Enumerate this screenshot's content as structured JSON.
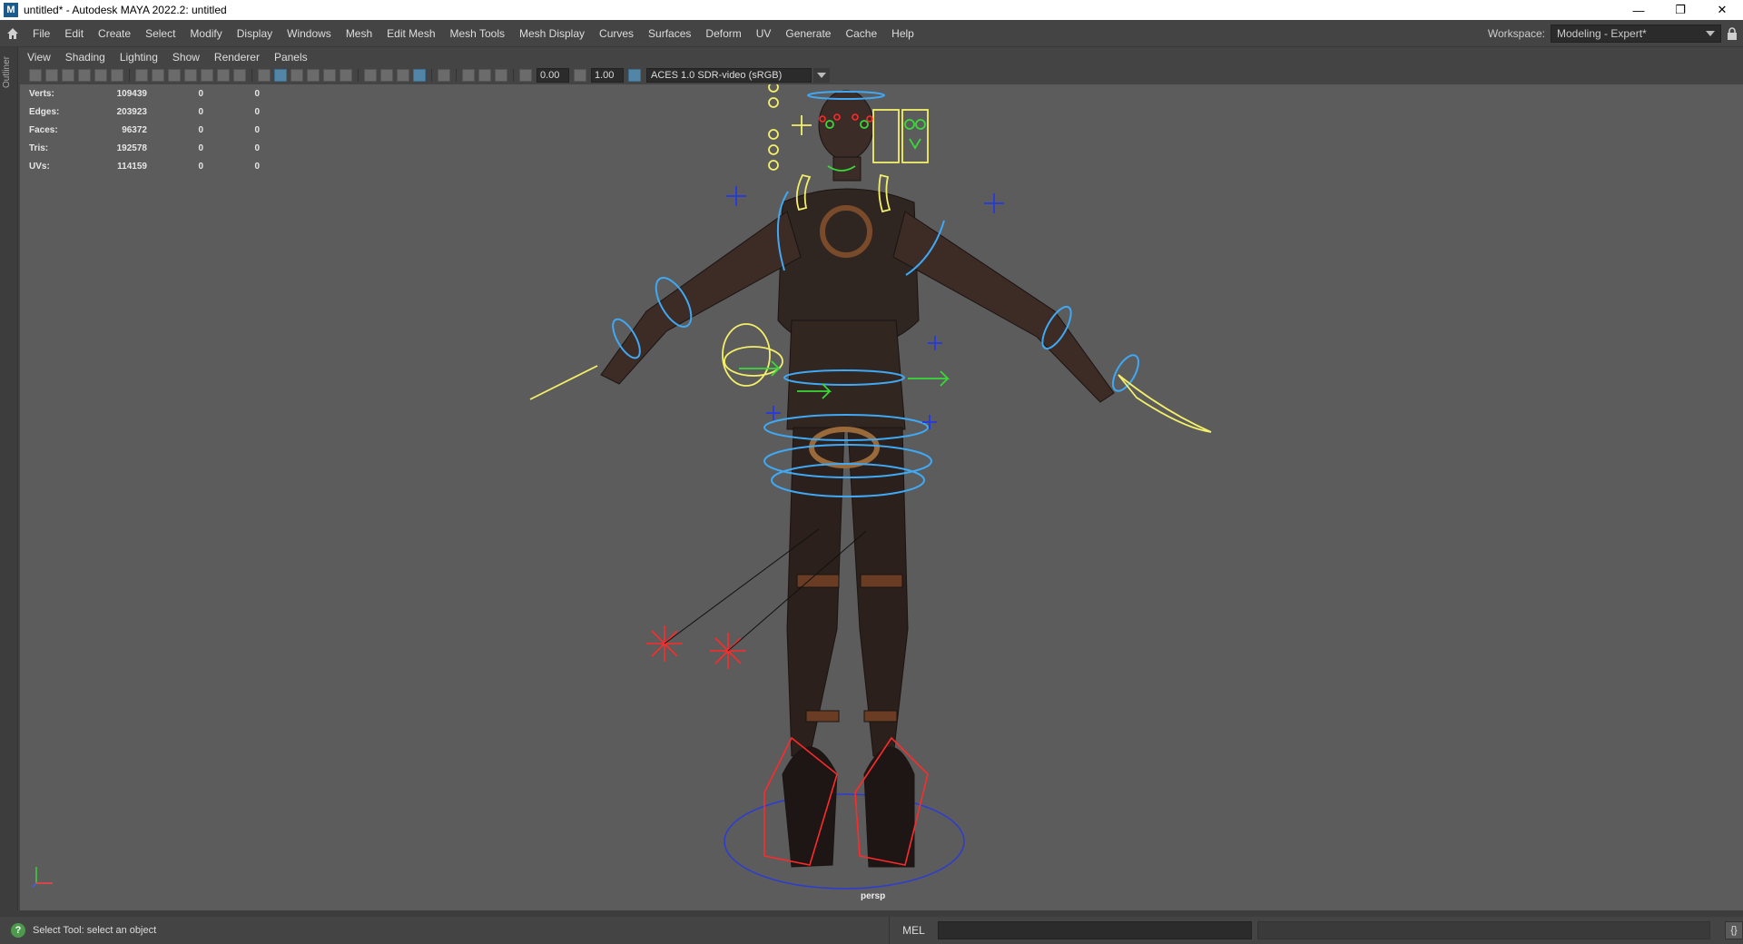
{
  "window": {
    "title": "untitled* - Autodesk MAYA 2022.2: untitled",
    "app_icon": "M",
    "minimize": "—",
    "restore": "❐",
    "close": "✕"
  },
  "menu": {
    "items": [
      "File",
      "Edit",
      "Create",
      "Select",
      "Modify",
      "Display",
      "Windows",
      "Mesh",
      "Edit Mesh",
      "Mesh Tools",
      "Mesh Display",
      "Curves",
      "Surfaces",
      "Deform",
      "UV",
      "Generate",
      "Cache",
      "Help"
    ]
  },
  "workspace": {
    "label": "Workspace:",
    "value": "Modeling - Expert*"
  },
  "outliner": {
    "label": "Outliner"
  },
  "panel_menu": {
    "items": [
      "View",
      "Shading",
      "Lighting",
      "Show",
      "Renderer",
      "Panels"
    ]
  },
  "viewport_toolbar": {
    "exposure": "0.00",
    "gamma": "1.00",
    "color_management": "ACES 1.0 SDR-video (sRGB)"
  },
  "hud": {
    "rows": [
      {
        "label": "Verts:",
        "v1": "109439",
        "v2": "0",
        "v3": "0"
      },
      {
        "label": "Edges:",
        "v1": "203923",
        "v2": "0",
        "v3": "0"
      },
      {
        "label": "Faces:",
        "v1": "96372",
        "v2": "0",
        "v3": "0"
      },
      {
        "label": "Tris:",
        "v1": "192578",
        "v2": "0",
        "v3": "0"
      },
      {
        "label": "UVs:",
        "v1": "114159",
        "v2": "0",
        "v3": "0"
      }
    ]
  },
  "viewport": {
    "camera": "persp",
    "background": "#5c5c5c"
  },
  "helpline": {
    "icon": "?",
    "text": "Select Tool: select an object",
    "mel": "MEL",
    "script_icon": "{}"
  },
  "colors": {
    "rig_blue": "#3fa9f5",
    "rig_yellow": "#f4f06a",
    "rig_green": "#39d93a",
    "rig_red": "#ff2a2a",
    "rig_dark_blue": "#2b3bd6"
  }
}
